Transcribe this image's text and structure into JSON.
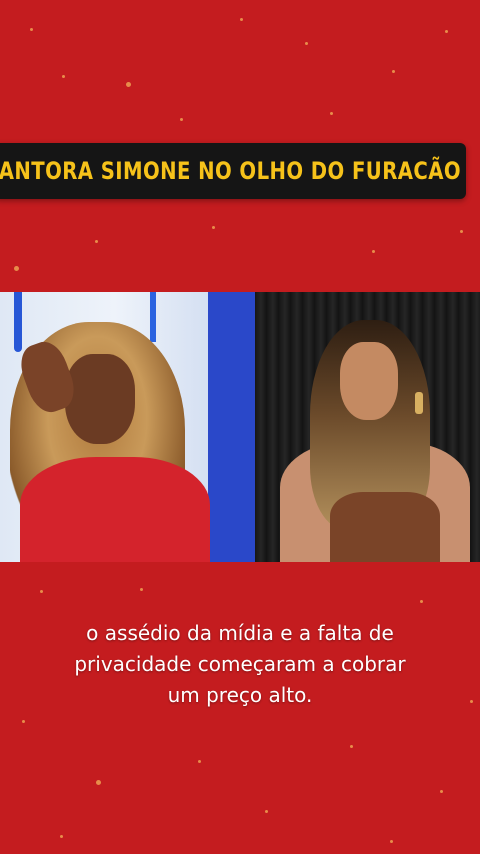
{
  "title_banner": {
    "text": "ANTORA SIMONE NO OLHO DO FURACÃO"
  },
  "video": {
    "left_person": "woman-with-curly-hair-in-tv-studio",
    "right_person": "woman-in-brown-leather-dress"
  },
  "caption": {
    "lines": [
      "o assédio da mídia e a falta de",
      "privacidade começaram a cobrar",
      "um preço alto."
    ]
  },
  "colors": {
    "background": "#c41c1f",
    "banner_bg": "#151515",
    "banner_text": "#f6c21a",
    "caption_text": "#ffffff"
  }
}
